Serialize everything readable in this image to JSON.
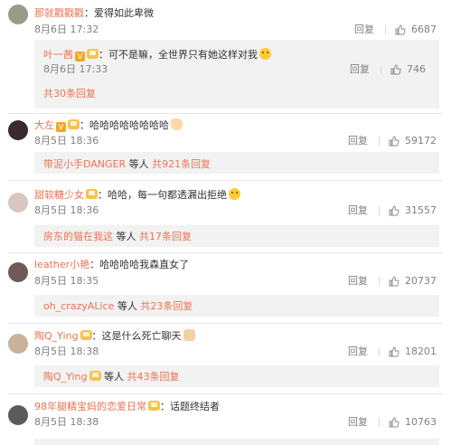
{
  "comments": [
    {
      "user": "那就戳戳戳",
      "text": "：爱得如此卑微",
      "time": "8月6日 17:32",
      "reply_label": "回复",
      "likes": "6687",
      "avatar_color": "#9a9a88"
    },
    {
      "user": "叶一茜",
      "text": "：可不是嘛，全世界只有她这样对我",
      "time": "8月6日 17:33",
      "reply_label": "回复",
      "likes": "746",
      "avatar_color": "#c9b59a"
    },
    {
      "user": "大左",
      "text": "：哈哈哈哈哈哈哈哈",
      "time": "8月5日 18:36",
      "reply_label": "回复",
      "likes": "59172",
      "avatar_color": "#3a2a30",
      "replies_user": "带泥小手DANGER",
      "replies_mid": " 等人 ",
      "replies_count": "共921条回复"
    },
    {
      "user": "甜软糖少女",
      "text": "：哈哈，每一句都透漏出拒绝",
      "time": "8月5日 18:36",
      "reply_label": "回复",
      "likes": "31557",
      "avatar_color": "#d7c7c0",
      "replies_user": "房东的猫在我这",
      "replies_mid": " 等人 ",
      "replies_count": "共17条回复"
    },
    {
      "user": "leather小艳",
      "text": "：哈哈哈哈我森直女了",
      "time": "8月5日 18:35",
      "reply_label": "回复",
      "likes": "20737",
      "avatar_color": "#6e5a58",
      "replies_user": "oh_crazyALice",
      "replies_mid": " 等人 ",
      "replies_count": "共23条回复"
    },
    {
      "user": "陶Q_Ying",
      "text": "：这是什么死亡聊天",
      "time": "8月5日 18:38",
      "reply_label": "回复",
      "likes": "18201",
      "avatar_color": "#c8b29a",
      "replies_user": "陶Q_Ying",
      "replies_mid": " 等人 ",
      "replies_count": "共43条回复"
    },
    {
      "user": "98年腿精宝妈的恋爱日常",
      "text": "：话题终结者",
      "time": "8月5日 18:38",
      "reply_label": "回复",
      "likes": "10763",
      "avatar_color": "#5a5a60"
    }
  ],
  "sub_thread_count": "共30条回复",
  "colors": {
    "link": "#eb7350",
    "meta": "#808080",
    "subbox": "#f2f2f2"
  }
}
